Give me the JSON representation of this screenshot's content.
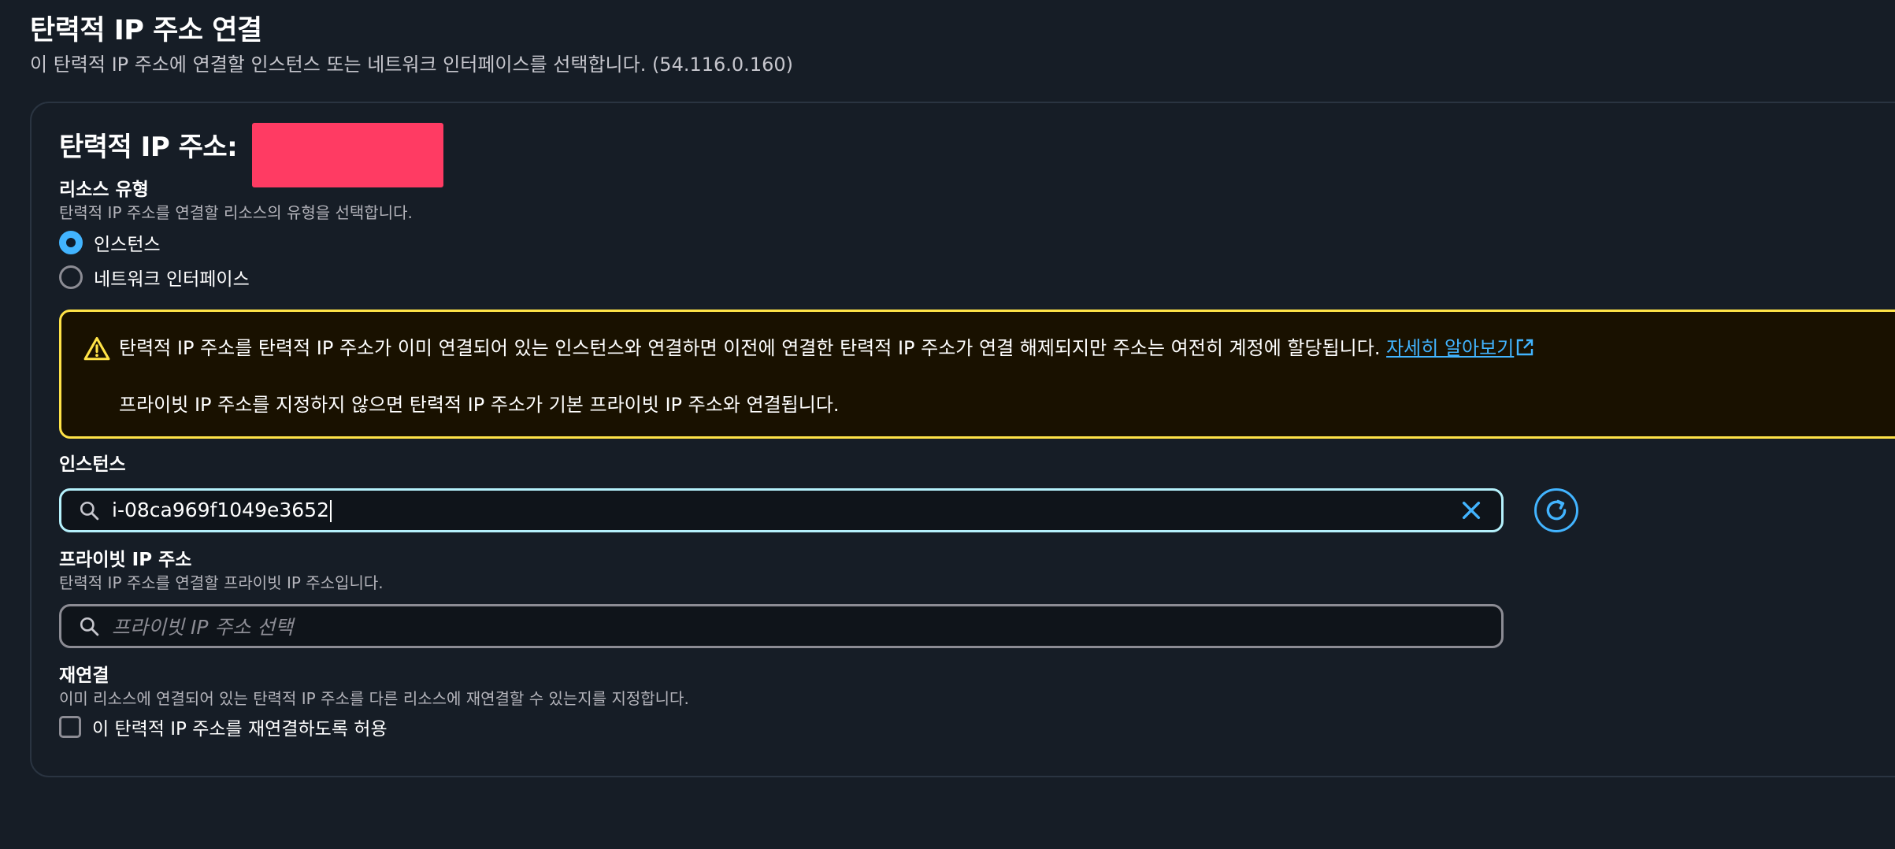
{
  "header": {
    "title": "탄력적 IP 주소 연결",
    "description": "이 탄력적 IP 주소에 연결할 인스턴스 또는 네트워크 인터페이스를 선택합니다. (54.116.0.160)"
  },
  "panel": {
    "title": "탄력적 IP 주소:"
  },
  "resource_type": {
    "label": "리소스 유형",
    "description": "탄력적 IP 주소를 연결할 리소스의 유형을 선택합니다.",
    "options": [
      {
        "label": "인스턴스",
        "selected": true
      },
      {
        "label": "네트워크 인터페이스",
        "selected": false
      }
    ]
  },
  "alert": {
    "icon": "warning-icon",
    "line1": "탄력적 IP 주소를 탄력적 IP 주소가 이미 연결되어 있는 인스턴스와 연결하면 이전에 연결한 탄력적 IP 주소가 연결 해제되지만 주소는 여전히 계정에 할당됩니다.",
    "link_label": "자세히 알아보기",
    "line2": "프라이빗 IP 주소를 지정하지 않으면 탄력적 IP 주소가 기본 프라이빗 IP 주소와 연결됩니다.",
    "border_color": "#ffe347",
    "background_color": "#191100"
  },
  "instance": {
    "label": "인스턴스",
    "value": "i-08ca969f1049e3652"
  },
  "private_ip": {
    "label": "프라이빗 IP 주소",
    "description": "탄력적 IP 주소를 연결할 프라이빗 IP 주소입니다.",
    "placeholder": "프라이빗 IP 주소 선택"
  },
  "reassociation": {
    "label": "재연결",
    "description": "이미 리소스에 연결되어 있는 탄력적 IP 주소를 다른 리소스에 재연결할 수 있는지를 지정합니다.",
    "checkbox_label": "이 탄력적 IP 주소를 재연결하도록 허용",
    "checked": false
  },
  "colors": {
    "background": "#161d26",
    "accent": "#42b4ff",
    "redaction": "#ff3b63"
  }
}
